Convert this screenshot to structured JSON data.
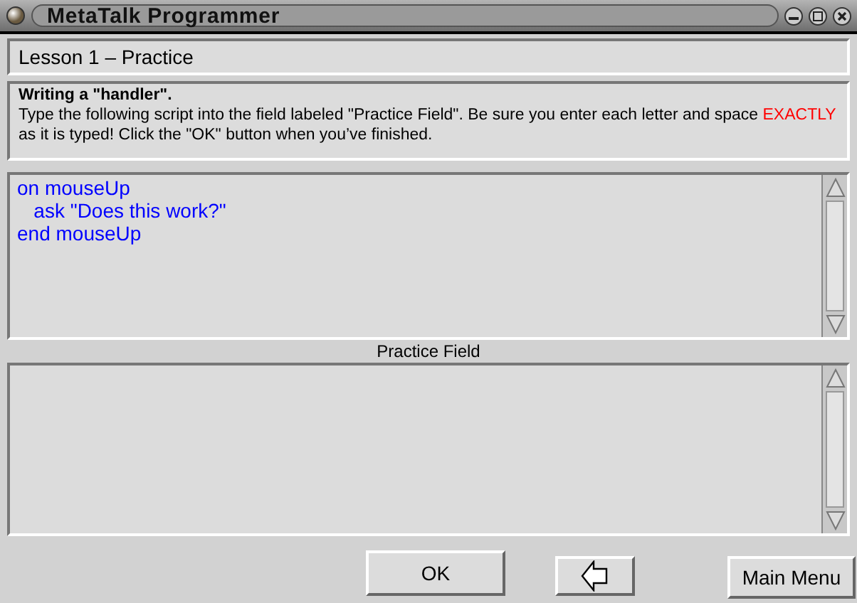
{
  "window": {
    "title": "MetaTalk Programmer"
  },
  "lesson": {
    "title": "Lesson 1 – Practice"
  },
  "instructions": {
    "heading": "Writing a \"handler\".",
    "body": [
      {
        "kind": "plain",
        "text": "Type the following script into the field labeled \"Practice Field\".  Be sure you enter each letter and space "
      },
      {
        "kind": "emphasis",
        "text": "EXACTLY"
      },
      {
        "kind": "plain",
        "text": " as it is typed!  Click the \"OK\" button when you’ve finished."
      }
    ]
  },
  "script_lines": [
    "on mouseUp",
    "   ask \"Does this work?\"",
    "end mouseUp"
  ],
  "practice_field": {
    "label": "Practice Field"
  },
  "buttons": [
    {
      "kind": "text",
      "label": "OK"
    },
    {
      "kind": "back"
    },
    {
      "kind": "text",
      "label": "Main Menu"
    }
  ]
}
